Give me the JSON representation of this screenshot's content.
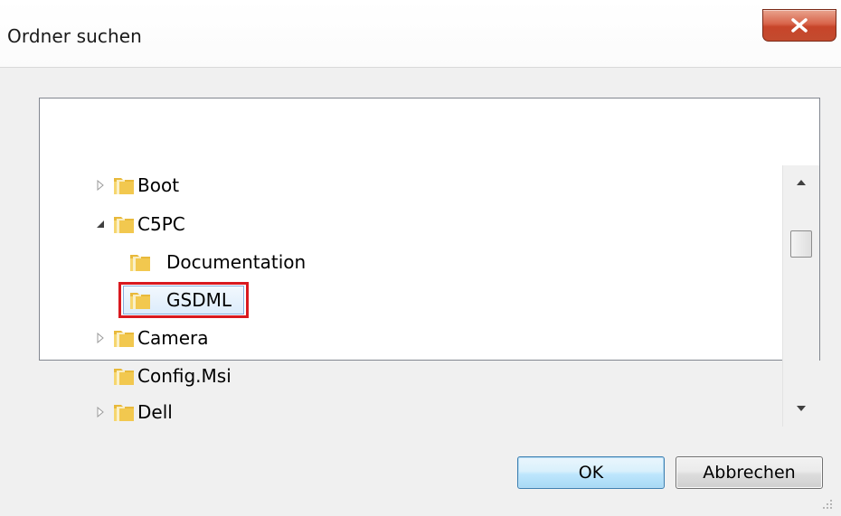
{
  "window": {
    "title": "Ordner suchen"
  },
  "tree": {
    "items": [
      {
        "label": "Boot",
        "expander": "collapsed",
        "icon": "folder-icon"
      },
      {
        "label": "C5PC",
        "expander": "expanded",
        "icon": "folder-icon"
      },
      {
        "label": "Documentation",
        "expander": "none",
        "icon": "folder-icon"
      },
      {
        "label": "GSDML",
        "expander": "none",
        "icon": "folder-icon",
        "selected": true
      },
      {
        "label": "Camera",
        "expander": "collapsed",
        "icon": "folder-icon"
      },
      {
        "label": "Config.Msi",
        "expander": "none",
        "icon": "folder-icon"
      },
      {
        "label": "Dell",
        "expander": "collapsed",
        "icon": "folder-icon"
      }
    ]
  },
  "buttons": {
    "ok_label": "OK",
    "cancel_label": "Abbrechen"
  },
  "colors": {
    "highlight_border": "#d9191f",
    "close_button": "#c7452a",
    "folder_yellow": "#f2c94c"
  }
}
